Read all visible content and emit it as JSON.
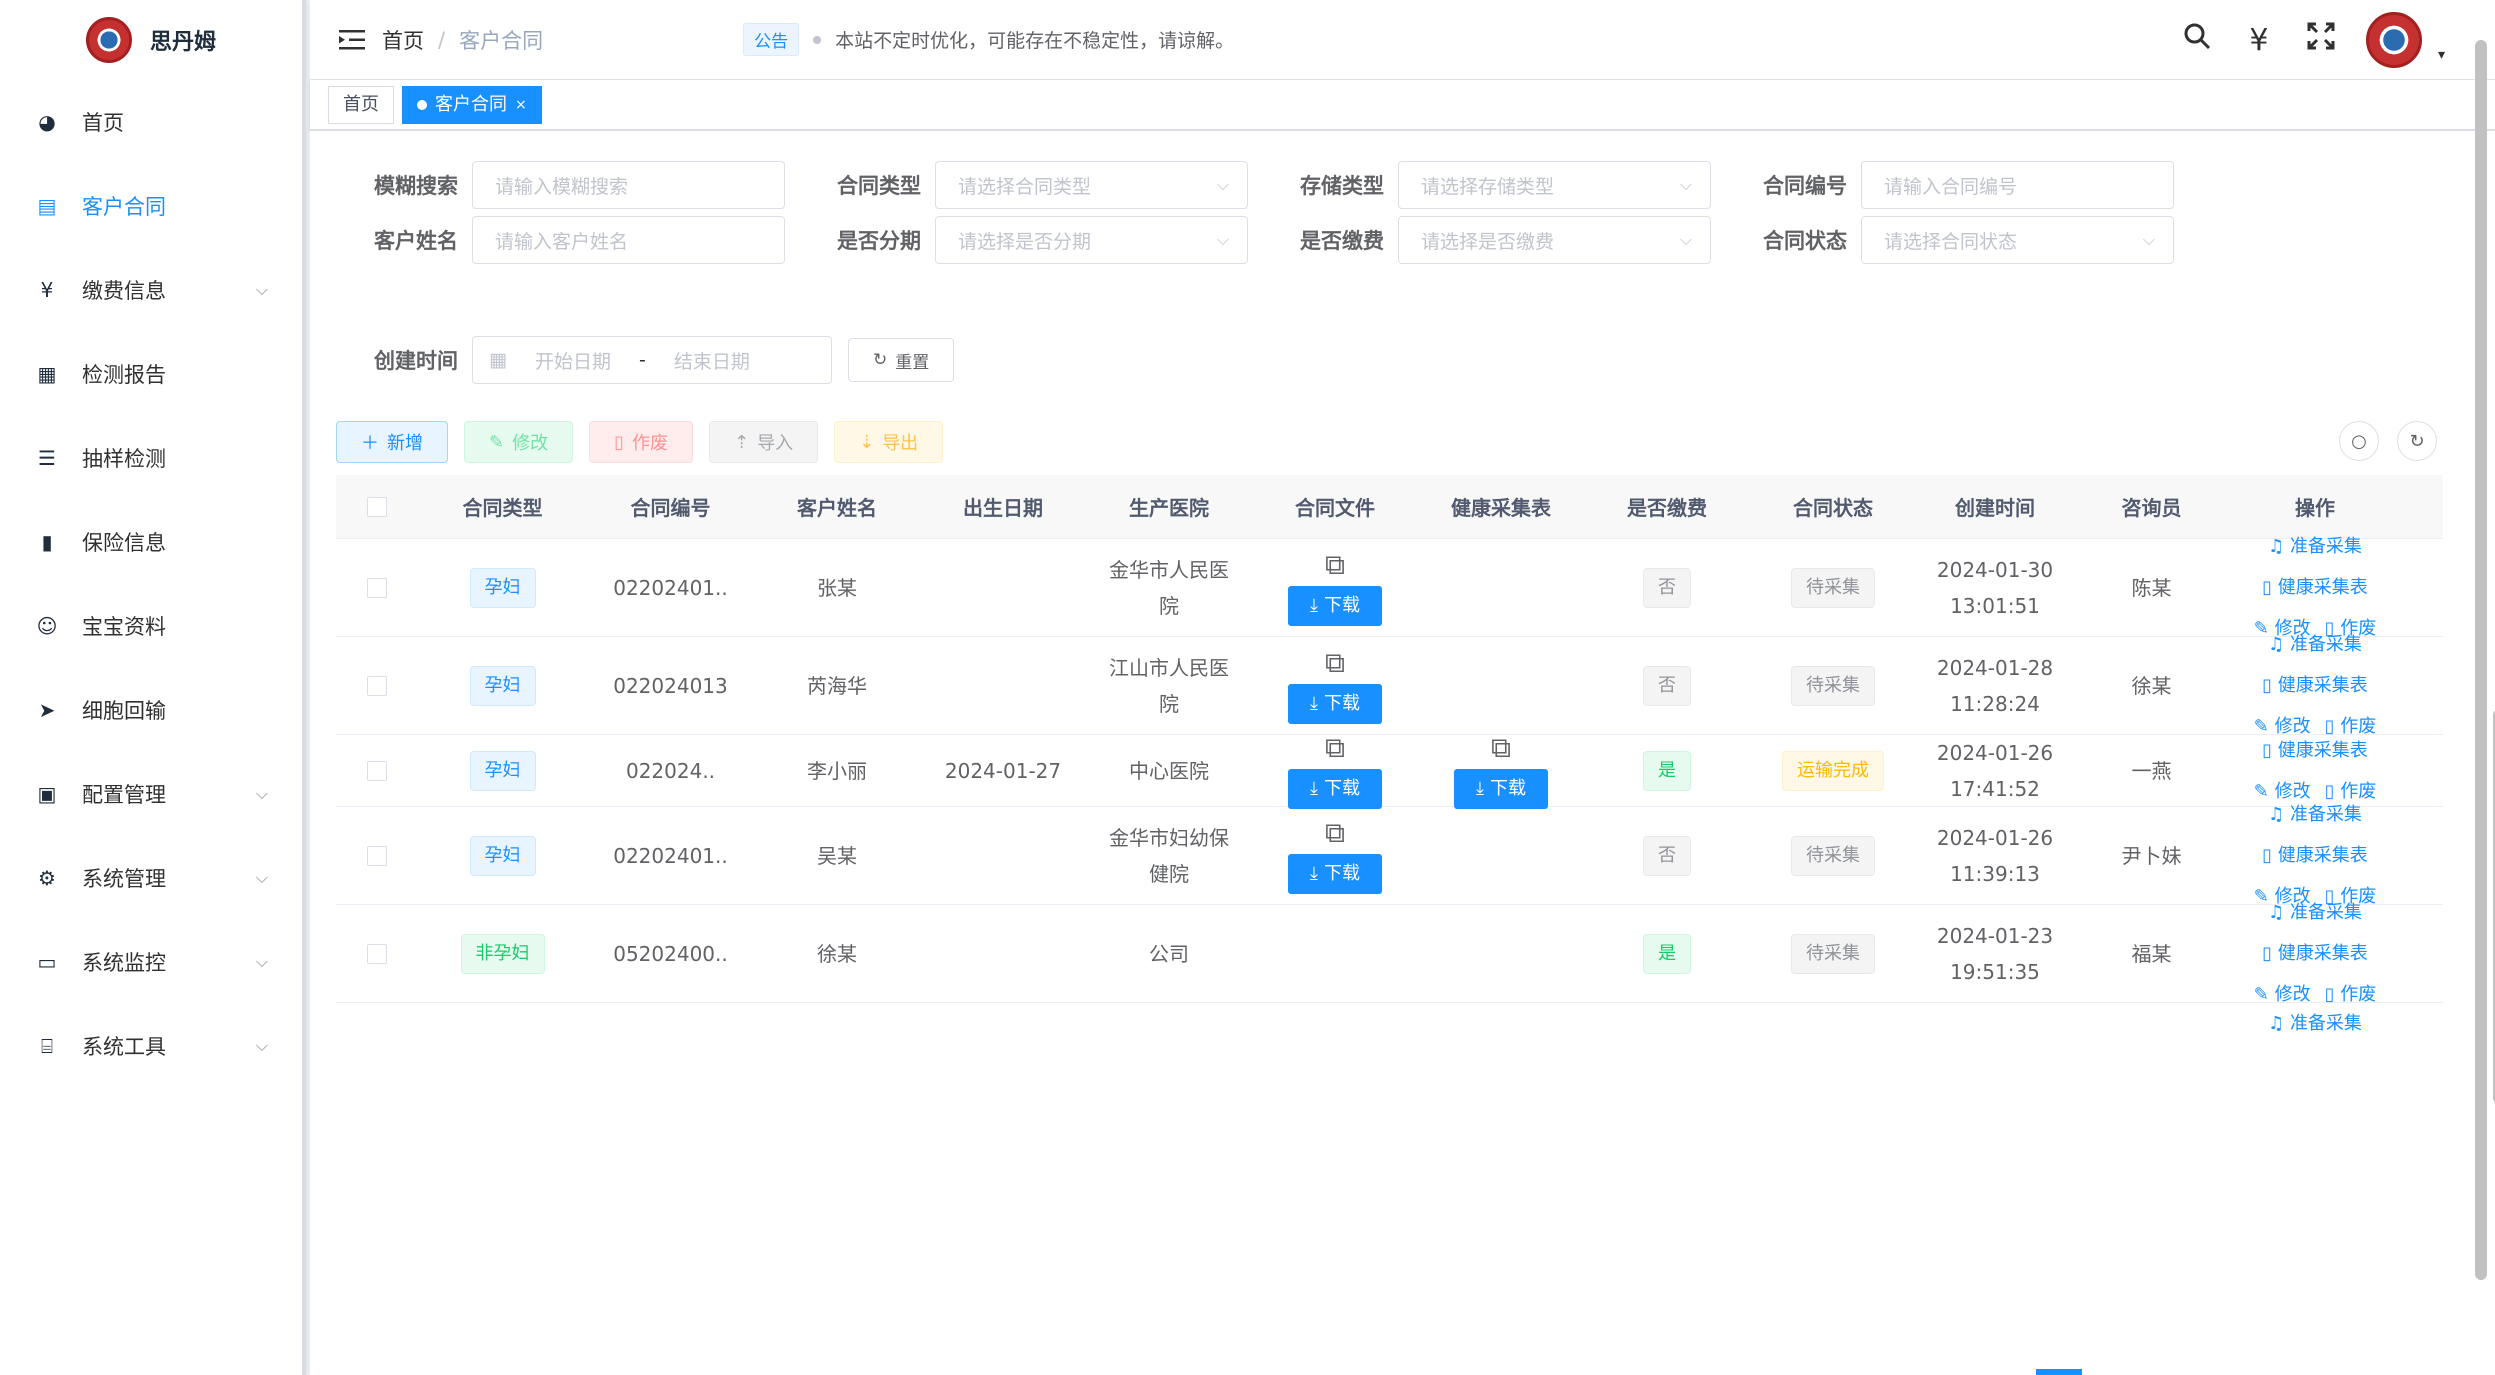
{
  "app": {
    "title": "思丹姆"
  },
  "sidebar": {
    "items": [
      {
        "label": "首页",
        "icon": "dashboard-icon",
        "glyph": "◕",
        "active": false,
        "has_children": false
      },
      {
        "label": "客户合同",
        "icon": "document-icon",
        "glyph": "▤",
        "active": true,
        "has_children": false
      },
      {
        "label": "缴费信息",
        "icon": "yen-icon",
        "glyph": "¥",
        "active": false,
        "has_children": true
      },
      {
        "label": "检测报告",
        "icon": "report-icon",
        "glyph": "▦",
        "active": false,
        "has_children": false
      },
      {
        "label": "抽样检测",
        "icon": "list-icon",
        "glyph": "☰",
        "active": false,
        "has_children": false
      },
      {
        "label": "保险信息",
        "icon": "info-icon",
        "glyph": "▮",
        "active": false,
        "has_children": false
      },
      {
        "label": "宝宝资料",
        "icon": "baby-icon",
        "glyph": "☺",
        "active": false,
        "has_children": false
      },
      {
        "label": "细胞回输",
        "icon": "send-icon",
        "glyph": "➤",
        "active": false,
        "has_children": false
      },
      {
        "label": "配置管理",
        "icon": "config-icon",
        "glyph": "▣",
        "active": false,
        "has_children": true
      },
      {
        "label": "系统管理",
        "icon": "gear-icon",
        "glyph": "⚙",
        "active": false,
        "has_children": true
      },
      {
        "label": "系统监控",
        "icon": "monitor-icon",
        "glyph": "▭",
        "active": false,
        "has_children": true
      },
      {
        "label": "系统工具",
        "icon": "tool-icon",
        "glyph": "⌸",
        "active": false,
        "has_children": true
      }
    ]
  },
  "header": {
    "breadcrumb": {
      "home": "首页",
      "sep": "/",
      "current": "客户合同"
    },
    "notice": {
      "tag": "公告",
      "text": "本站不定时优化，可能存在不稳定性，请谅解。"
    }
  },
  "tags": {
    "home": "首页",
    "current": "客户合同",
    "close": "×"
  },
  "filters": {
    "fuzzy": {
      "label": "模糊搜索",
      "placeholder": "请输入模糊搜索"
    },
    "contract_type": {
      "label": "合同类型",
      "placeholder": "请选择合同类型"
    },
    "storage_type": {
      "label": "存储类型",
      "placeholder": "请选择存储类型"
    },
    "contract_no": {
      "label": "合同编号",
      "placeholder": "请输入合同编号"
    },
    "customer_name": {
      "label": "客户姓名",
      "placeholder": "请输入客户姓名"
    },
    "installment": {
      "label": "是否分期",
      "placeholder": "请选择是否分期"
    },
    "paid": {
      "label": "是否缴费",
      "placeholder": "请选择是否缴费"
    },
    "status": {
      "label": "合同状态",
      "placeholder": "请选择合同状态"
    },
    "created": {
      "label": "创建时间",
      "start": "开始日期",
      "sep": "-",
      "end": "结束日期"
    },
    "reset": "重置"
  },
  "toolbar": {
    "add": "新增",
    "edit": "修改",
    "delete": "作废",
    "import": "导入",
    "export": "导出"
  },
  "table": {
    "columns": [
      "合同类型",
      "合同编号",
      "客户姓名",
      "出生日期",
      "生产医院",
      "合同文件",
      "健康采集表",
      "是否缴费",
      "合同状态",
      "创建时间",
      "咨询员",
      "操作"
    ],
    "download": "下载",
    "ops": {
      "prepare": "准备采集",
      "health": "健康采集表",
      "edit": "修改",
      "void": "作废"
    },
    "rows": [
      {
        "type": "孕妇",
        "type_color": "blue",
        "no": "02202401..",
        "name": "张某",
        "birth": "",
        "hospital": [
          "金华市人民医",
          "院"
        ],
        "has_file": true,
        "has_health": false,
        "paid": "否",
        "paid_color": "gray",
        "status": "待采集",
        "status_color": "gray",
        "created": [
          "2024-01-30",
          "13:01:51"
        ],
        "consultant": "陈某",
        "ops": [
          "prepare",
          "health",
          "edit_void"
        ]
      },
      {
        "type": "孕妇",
        "type_color": "blue",
        "no": "022024013",
        "name": "芮海华",
        "birth": "",
        "hospital": [
          "江山市人民医",
          "院"
        ],
        "has_file": true,
        "has_health": false,
        "paid": "否",
        "paid_color": "gray",
        "status": "待采集",
        "status_color": "gray",
        "created": [
          "2024-01-28",
          "11:28:24"
        ],
        "consultant": "徐某",
        "ops": [
          "prepare",
          "health",
          "edit_void"
        ]
      },
      {
        "type": "孕妇",
        "type_color": "blue",
        "no": "022024..",
        "name": "李小丽",
        "birth": "2024-01-27",
        "hospital": [
          "中心医院"
        ],
        "has_file": true,
        "has_health": true,
        "paid": "是",
        "paid_color": "green",
        "status": "运输完成",
        "status_color": "yellow",
        "created": [
          "2024-01-26",
          "17:41:52"
        ],
        "consultant": "一燕",
        "ops": [
          "health",
          "edit_void"
        ]
      },
      {
        "type": "孕妇",
        "type_color": "blue",
        "no": "02202401..",
        "name": "吴某",
        "birth": "",
        "hospital": [
          "金华市妇幼保",
          "健院"
        ],
        "has_file": true,
        "has_health": false,
        "paid": "否",
        "paid_color": "gray",
        "status": "待采集",
        "status_color": "gray",
        "created": [
          "2024-01-26",
          "11:39:13"
        ],
        "consultant": "尹卜妹",
        "ops": [
          "prepare",
          "health",
          "edit_void"
        ]
      },
      {
        "type": "非孕妇",
        "type_color": "green",
        "no": "05202400..",
        "name": "徐某",
        "birth": "",
        "hospital": [
          "公司"
        ],
        "has_file": false,
        "has_health": false,
        "paid": "是",
        "paid_color": "green",
        "status": "待采集",
        "status_color": "gray",
        "created": [
          "2024-01-23",
          "19:51:35"
        ],
        "consultant": "福某",
        "ops": [
          "prepare",
          "health",
          "edit_void"
        ]
      }
    ],
    "partial_row_op": "准备采集"
  }
}
